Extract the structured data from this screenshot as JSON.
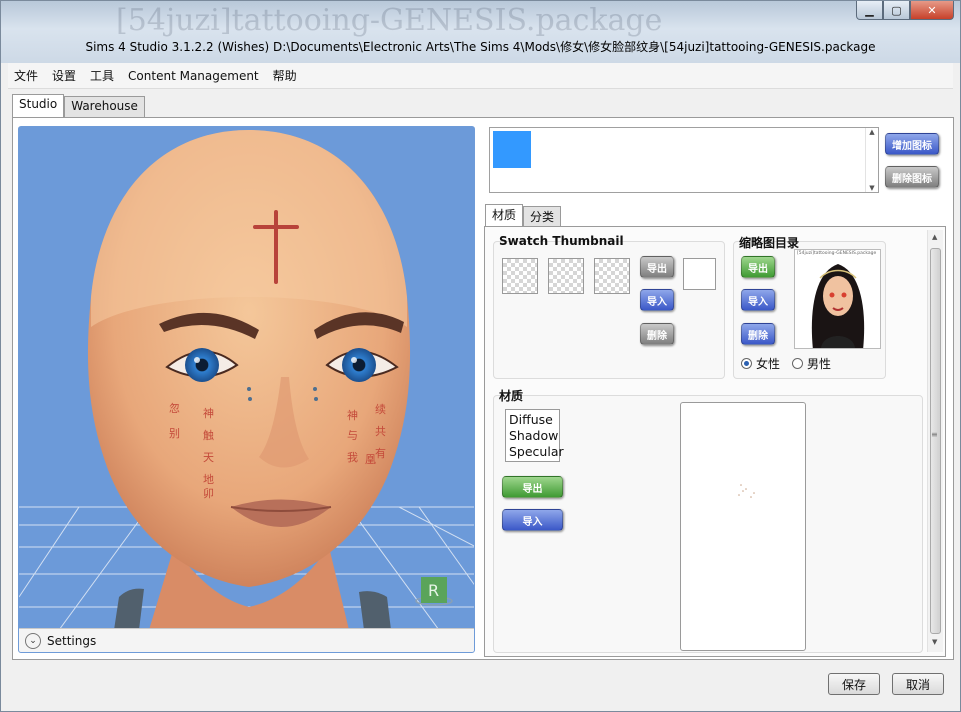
{
  "window": {
    "ghost_title": "[54juzi]tattooing-GENESIS.package",
    "title": "Sims 4 Studio 3.1.2.2 (Wishes)  D:\\Documents\\Electronic Arts\\The Sims 4\\Mods\\修女\\修女脸部纹身\\[54juzi]tattooing-GENESIS.package",
    "controls": {
      "minimize": "▁",
      "maximize": "▢",
      "close": "✕"
    }
  },
  "menu": {
    "items": [
      "文件",
      "设置",
      "工具",
      "Content Management",
      "帮助"
    ]
  },
  "top_tabs": [
    "Studio",
    "Warehouse"
  ],
  "viewport": {
    "settings_label": "Settings",
    "r_badge": "R",
    "cheek_text_left": [
      "忽",
      "别",
      "神",
      "触",
      "天",
      "地",
      "卯"
    ],
    "cheek_text_right": [
      "神",
      "与",
      "我",
      "续",
      "共",
      "有",
      "凰"
    ]
  },
  "swatch_panel": {
    "swatch_color": "#3399ff",
    "add_icon_btn": "增加图标",
    "delete_icon_btn": "删除图标"
  },
  "sub_tabs": [
    "材质",
    "分类"
  ],
  "swatch_thumbnail": {
    "title": "Swatch Thumbnail",
    "export_btn": "导出",
    "import_btn": "导入",
    "delete_btn": "删除"
  },
  "thumbnail_dir": {
    "title": "缩略图目录",
    "export_btn": "导出",
    "import_btn": "导入",
    "delete_btn": "删除",
    "preview_caption": "[54juzi]tattooing-GENESIS.package",
    "gender_female": "女性",
    "gender_male": "男性",
    "selected_gender": "女性"
  },
  "material": {
    "title": "材质",
    "list": [
      "Diffuse",
      "Shadow",
      "Specular"
    ],
    "export_btn": "导出",
    "import_btn": "导入"
  },
  "footer": {
    "save": "保存",
    "cancel": "取消"
  }
}
